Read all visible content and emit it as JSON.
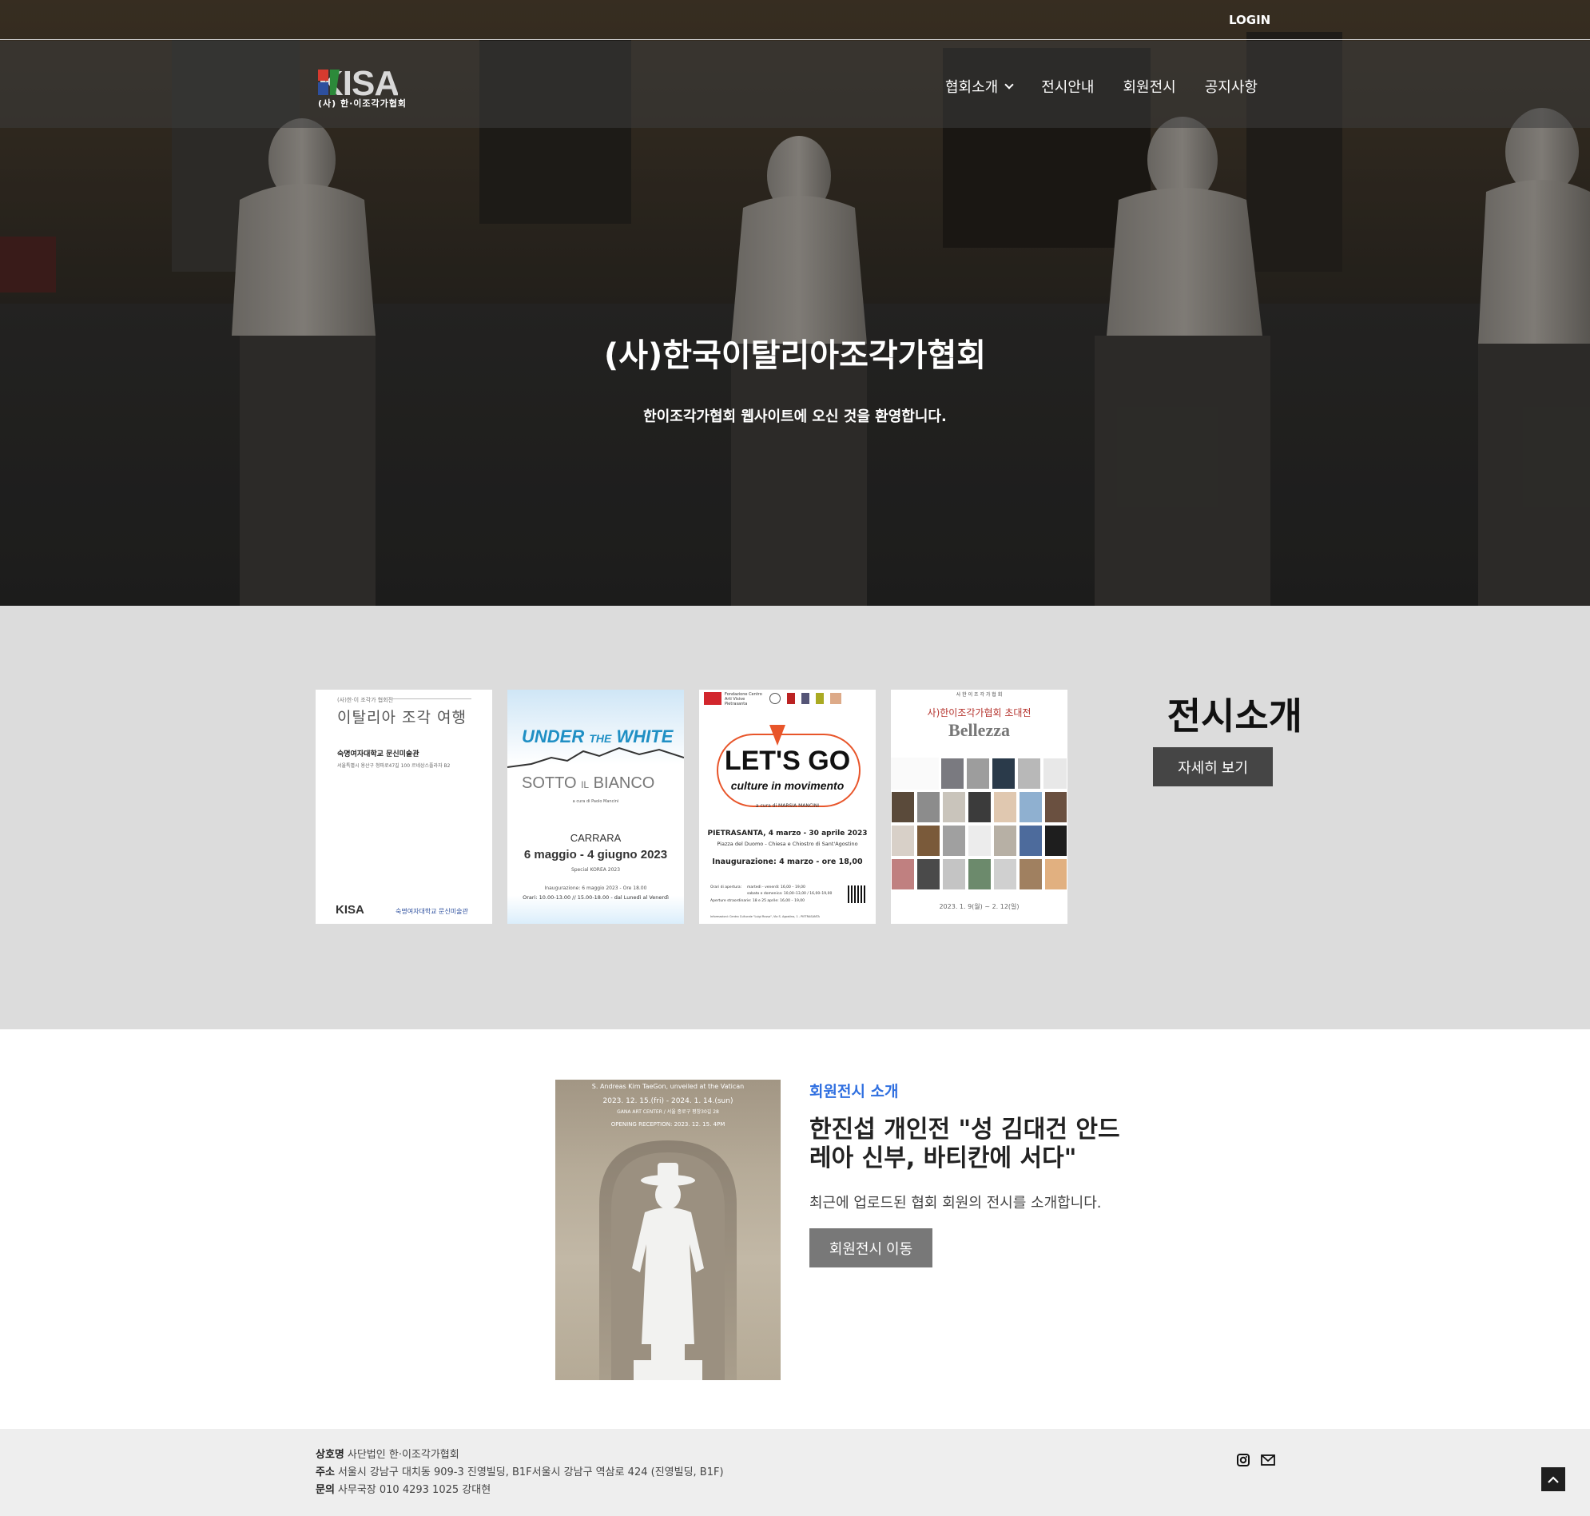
{
  "header": {
    "login_label": "LOGIN",
    "logo_text": "KISA",
    "logo_sub": "(사) 한·이조각가협회",
    "nav": [
      {
        "label": "협회소개",
        "has_dropdown": true
      },
      {
        "label": "전시안내",
        "has_dropdown": false
      },
      {
        "label": "회원전시",
        "has_dropdown": false
      },
      {
        "label": "공지사항",
        "has_dropdown": false
      }
    ]
  },
  "hero": {
    "title": "(사)한국이탈리아조각가협회",
    "subtitle": "한이조각가협회 웹사이트에 오신 것을 환영합니다."
  },
  "exhibition": {
    "title": "전시소개",
    "button_label": "자세히 보기",
    "posters": [
      {
        "top": "(사)한·이 조각가 협회전",
        "title": "이탈리아 조각 여행",
        "venue": "숙명여자대학교 문신미술관",
        "address": "서울특별시 용산구 청파로47길 100 르네상스플라자 B2",
        "footer_logo": "KISA",
        "footer_partner": "숙명여자대학교 문신미술관"
      },
      {
        "title_a": "UNDER",
        "title_b": "THE",
        "title_c": "WHITE",
        "subtitle_a": "SOTTO",
        "subtitle_b": "IL",
        "subtitle_c": "BIANCO",
        "curator": "a cura di Paolo Mancini",
        "city": "CARRARA",
        "dates": "6 maggio - 4 giugno 2023",
        "special": "Special KOREA 2023",
        "opening": "Inaugurazione: 6 maggio 2023 - Ore 18.00",
        "hours": "Orari: 10.00-13.00 // 15.00-18.00 - dal Lunedì al Venerdì"
      },
      {
        "org": "Fondazione Centro Arti Visive Pietrasanta",
        "title": "LET'S GO",
        "subtitle": "culture in movimento",
        "curator": "a cura di MARSIA MANCINI",
        "place": "PIETRASANTA, 4 marzo - 30 aprile 2023",
        "venue": "Piazza del Duomo - Chiesa e Chiostro di Sant'Agostino",
        "opening": "Inaugurazione: 4 marzo - ore 18,00",
        "hours_label": "Orari di apertura:",
        "hours_1": "martedì - venerdì: 16,00 – 19,00",
        "hours_2": "sabato e domenica: 10,00–13,00 / 16,00–19,00",
        "hours_3": "Aperture straordinarie: 18 e 25 aprile: 16,00 – 19,00",
        "info": "Informazioni: Centro Culturale \"Luigi Russo\", Via S. Agostino, 1 - PIETRASANTA"
      },
      {
        "top": "사 한 이 조 각 가 협 회",
        "subtitle": "사)한이조각가협회 초대전",
        "title": "Bellezza",
        "dates": "2023. 1. 9(월) ~ 2. 12(일)"
      }
    ]
  },
  "member": {
    "kicker": "회원전시 소개",
    "title": "한진섭 개인전 \"성 김대건 안드레아 신부, 바티칸에 서다\"",
    "description": "최근에 업로드된 협회 회원의 전시를 소개합니다.",
    "button_label": "회원전시 이동",
    "poster_top": "S. Andreas Kim TaeGon, unveiled at the Vatican",
    "poster_dates": "2023. 12. 15.(fri) - 2024. 1. 14.(sun)",
    "poster_venue": "GANA ART CENTER / 서울 종로구 평창30길 28",
    "poster_reception": "OPENING RECEPTION: 2023. 12. 15. 4PM"
  },
  "footer": {
    "company_label": "상호명",
    "company_value": "사단법인 한·이조각가협회",
    "address_label": "주소",
    "address_value": "서울시 강남구 대치동 909-3 진영빌딩, B1F서울시 강남구 역삼로 424 (진영빌딩, B1F)",
    "contact_label": "문의",
    "contact_value": "사무국장 010 4293 1025 강대현"
  },
  "icons": {
    "dropdown": "chevron-down-icon",
    "instagram": "instagram-icon",
    "mail": "mail-icon",
    "scroll_top": "arrow-up-icon"
  },
  "colors": {
    "accent_blue": "#2f6fe0",
    "dark_button": "#454545",
    "grey_button": "#787878",
    "section_grey": "#dcdcdc",
    "footer_bg": "#eeeeee"
  }
}
